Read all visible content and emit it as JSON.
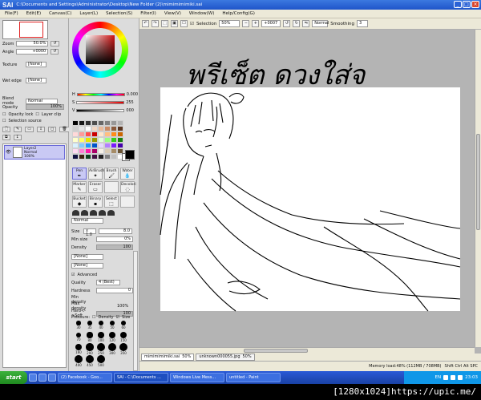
{
  "app": {
    "brand": "SAI",
    "title_path": "C:\\Documents and Settings\\Administrator\\Desktop\\New Folder (2)\\mimimimimiki.sai",
    "window_buttons": [
      "_",
      "□",
      "×"
    ]
  },
  "menu": [
    "File(F)",
    "Edit(E)",
    "Canvas(C)",
    "Layer(L)",
    "Selection(S)",
    "Filter(I)",
    "View(V)",
    "Window(W)",
    "Help/Config(G)"
  ],
  "navigator": {
    "zoom_label": "Zoom",
    "zoom_value": "50.0%",
    "angle_label": "Angle",
    "angle_value": "+0000"
  },
  "layer_props": {
    "texture_label": "Texture",
    "texture_value": "[None]",
    "wet_edge_label": "Wet edge",
    "wet_edge_value": "[None]",
    "blend_mode_label": "Blend mode",
    "blend_mode_value": "Normal",
    "opacity_label": "Opacity",
    "opacity_value": "100%",
    "opacity_fraction": 1.0,
    "opacity_lock": "Opacity lock",
    "layer_clip": "Layer clip",
    "selection_source": "Selection source"
  },
  "layers": [
    {
      "name": "Layer2",
      "mode": "Normal",
      "opacity": "100%"
    }
  ],
  "color": {
    "h_label": "H",
    "h_value": "0.000",
    "s_label": "S",
    "s_value": "255",
    "v_label": "V",
    "v_value": "000",
    "primary": "#000000",
    "secondary": "#ffffff",
    "swatches": [
      "#000000",
      "#1a1a1a",
      "#333333",
      "#4d4d4d",
      "#666666",
      "#808080",
      "#999999",
      "#b3b3b3",
      "#cccccc",
      "#e6e6e6",
      "#ffffff",
      "#f2d7c4",
      "#e8b99a",
      "#c98a64",
      "#8c5a3c",
      "#5a3520",
      "#ffd9d9",
      "#ff9999",
      "#ff4d4d",
      "#cc0000",
      "#ffe6cc",
      "#ffbf80",
      "#ff8c1a",
      "#cc6600",
      "#ffffcc",
      "#ffff66",
      "#e6e600",
      "#999900",
      "#e0ffd9",
      "#99ff80",
      "#33cc1a",
      "#1a800d",
      "#d9f2ff",
      "#80ccff",
      "#1a99ff",
      "#0055cc",
      "#e6d9ff",
      "#b380ff",
      "#7a1aff",
      "#4400aa",
      "#ffd9f2",
      "#ff80d4",
      "#ff1aaa",
      "#aa0066",
      "#f5f0e6",
      "#d9cbb3",
      "#a68c66",
      "#6b5536",
      "#101040",
      "#402010",
      "#104020",
      "#401040",
      "#202020",
      "#7f7f7f",
      "#bfbfbf",
      "#ffffff"
    ]
  },
  "tools": [
    {
      "label": "Pen",
      "icon": "pen-icon",
      "selected": true
    },
    {
      "label": "AirBrush",
      "icon": "airbrush-icon",
      "selected": false
    },
    {
      "label": "Brush",
      "icon": "brush-icon",
      "selected": false
    },
    {
      "label": "Water",
      "icon": "water-icon",
      "selected": false
    },
    {
      "label": "Marker",
      "icon": "marker-icon",
      "selected": false
    },
    {
      "label": "Eraser",
      "icon": "eraser-icon",
      "selected": false
    },
    {
      "label": "",
      "icon": "blank-tool-icon",
      "selected": false
    },
    {
      "label": "Decolori",
      "icon": "decolor-icon",
      "selected": false
    },
    {
      "label": "Bucket",
      "icon": "bucket-icon",
      "selected": false
    },
    {
      "label": "Binary",
      "icon": "binary-icon",
      "selected": false
    },
    {
      "label": "Select",
      "icon": "select-icon",
      "selected": false
    },
    {
      "label": "",
      "icon": "blank-tool-icon",
      "selected": false
    }
  ],
  "brush": {
    "mode_value": "Normal",
    "size_label": "Size",
    "size_mult": "x 1.0",
    "size_value": "8.0",
    "min_size_label": "Min size",
    "min_size_value": "0%",
    "density_label": "Density",
    "density_value": "100",
    "texture1": "[None]",
    "texture2": "[None]",
    "advanced_label": "Advanced",
    "quality_label": "Quality",
    "quality_value": "4 (Best)",
    "hardness_label": "Hardness",
    "hardness_value": "0",
    "min_density_label": "Min density",
    "max_density_label": "Max density",
    "max_density_value": "100%",
    "hard_soft_label": "Hard<->Soft",
    "hard_soft_value": "100",
    "pressure_label": "Pressure:",
    "pressure_density": "Density",
    "pressure_size": "Size"
  },
  "brush_sizes": [
    "30",
    "35",
    "40",
    "50",
    "60",
    "70",
    "80",
    "100",
    "120",
    "150",
    "160",
    "200",
    "250",
    "300",
    "350",
    "400",
    "450",
    "500"
  ],
  "canvas_toolbar": {
    "selection_label": "Selection",
    "zoom_value": "50%",
    "angle_value": "+0007",
    "mode_value": "Normal",
    "smoothing_label": "Smoothing",
    "smoothing_value": "3"
  },
  "canvas": {
    "handwriting": "พรีเซ็ต ดวงใส่จ"
  },
  "doc_tabs": [
    {
      "name": "mimimimimiki.sai",
      "zoom": "50%",
      "active": true
    },
    {
      "name": "unknown000055.jpg",
      "zoom": "50%",
      "active": false
    }
  ],
  "status": {
    "memory": "Memory load:48% (112MB / 708MB)",
    "keys": "Shift Ctrl Alt SPC"
  },
  "taskbar": {
    "start_label": "start",
    "items": [
      {
        "label": "(2) Facebook - Goo...",
        "active": false
      },
      {
        "label": "SAI - C:\\Documents ...",
        "active": true
      },
      {
        "label": "Windows Live Mess...",
        "active": false
      },
      {
        "label": "untitled - Paint",
        "active": false
      }
    ],
    "lang": "EN",
    "clock": "23:03"
  },
  "watermark": "[1280x1024]https://upic.me/"
}
